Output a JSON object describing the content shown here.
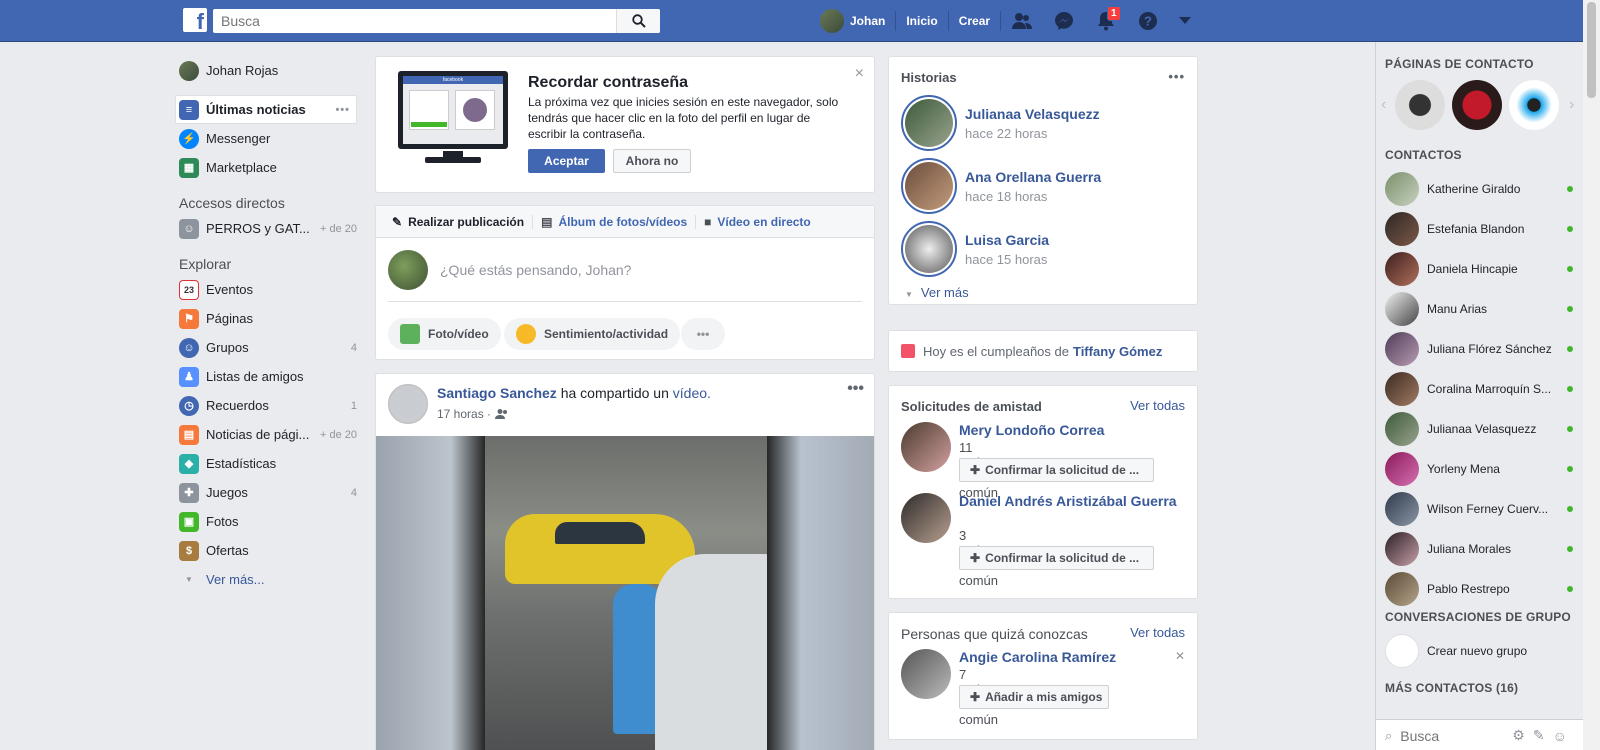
{
  "topbar": {
    "logo": "f",
    "search_placeholder": "Busca",
    "user_name": "Johan",
    "home_label": "Inicio",
    "create_label": "Crear",
    "notification_count": "1"
  },
  "sidebar": {
    "user": "Johan Rojas",
    "main_items": [
      {
        "label": "Últimas noticias",
        "icon": "news-feed-icon"
      },
      {
        "label": "Messenger",
        "icon": "messenger-icon"
      },
      {
        "label": "Marketplace",
        "icon": "marketplace-icon"
      }
    ],
    "shortcuts_heading": "Accesos directos",
    "shortcuts": [
      {
        "label": "PERROS y GAT...",
        "count": "+ de 20"
      }
    ],
    "explore_heading": "Explorar",
    "explore": [
      {
        "label": "Eventos",
        "count": ""
      },
      {
        "label": "Páginas",
        "count": ""
      },
      {
        "label": "Grupos",
        "count": "4"
      },
      {
        "label": "Listas de amigos",
        "count": ""
      },
      {
        "label": "Recuerdos",
        "count": "1"
      },
      {
        "label": "Noticias de pági...",
        "count": "+ de 20"
      },
      {
        "label": "Estadísticas",
        "count": ""
      },
      {
        "label": "Juegos",
        "count": "4"
      },
      {
        "label": "Fotos",
        "count": ""
      },
      {
        "label": "Ofertas",
        "count": ""
      }
    ],
    "see_more": "Ver más..."
  },
  "remember": {
    "monitor_label": "facebook",
    "title": "Recordar contraseña",
    "desc": "La próxima vez que inicies sesión en este navegador, solo tendrás que hacer clic en la foto del perfil en lugar de escribir la contraseña.",
    "accept": "Aceptar",
    "not_now": "Ahora no",
    "close": "×"
  },
  "composer": {
    "tabs": [
      "Realizar publicación",
      "Álbum de fotos/vídeos",
      "Vídeo en directo"
    ],
    "placeholder": "¿Qué estás pensando, Johan?",
    "photo_video": "Foto/vídeo",
    "feeling": "Sentimiento/actividad"
  },
  "post": {
    "author": "Santiago Sanchez",
    "action": "ha compartido un",
    "object": "vídeo.",
    "time": "17 horas ·"
  },
  "stories": {
    "title": "Historias",
    "items": [
      {
        "name": "Julianaa Velasquezz",
        "time": "hace 22 horas"
      },
      {
        "name": "Ana Orellana Guerra",
        "time": "hace 18 horas"
      },
      {
        "name": "Luisa Garcia",
        "time": "hace 15 horas"
      }
    ],
    "see_more": "Ver más"
  },
  "birthday": {
    "prefix": "Hoy es el cumpleaños de",
    "name": "Tiffany Gómez"
  },
  "requests": {
    "title": "Solicitudes de amistad",
    "see_all": "Ver todas",
    "items": [
      {
        "name": "Mery Londoño Correa",
        "mutual": "11 amigos en común",
        "button": "Confirmar la solicitud de ..."
      },
      {
        "name": "Daniel Andrés Aristizábal Guerra",
        "mutual": "3 amigos en común",
        "button": "Confirmar la solicitud de ..."
      }
    ]
  },
  "people": {
    "title": "Personas que quizá conozcas",
    "see_all": "Ver todas",
    "items": [
      {
        "name": "Angie Carolina Ramírez",
        "mutual": "7 amigos en común",
        "button": "Añadir a mis amigos"
      }
    ]
  },
  "chat": {
    "pages_heading": "PÁGINAS DE CONTACTO",
    "contacts_heading": "CONTACTOS",
    "contacts": [
      "Katherine Giraldo",
      "Estefania Blandon",
      "Daniela Hincapie",
      "Manu Arias",
      "Juliana Flórez Sánchez",
      "Coralina Marroquín S...",
      "Julianaa Velasquezz",
      "Yorleny Mena",
      "Wilson Ferney Cuerv...",
      "Juliana Morales",
      "Pablo Restrepo"
    ],
    "groups_heading": "CONVERSACIONES DE GRUPO",
    "new_group": "Crear nuevo grupo",
    "more_contacts": "MÁS CONTACTOS (16)",
    "search_placeholder": "Busca"
  },
  "colors": {
    "brand": "#4267b2",
    "link": "#385898",
    "online": "#42b72a"
  }
}
